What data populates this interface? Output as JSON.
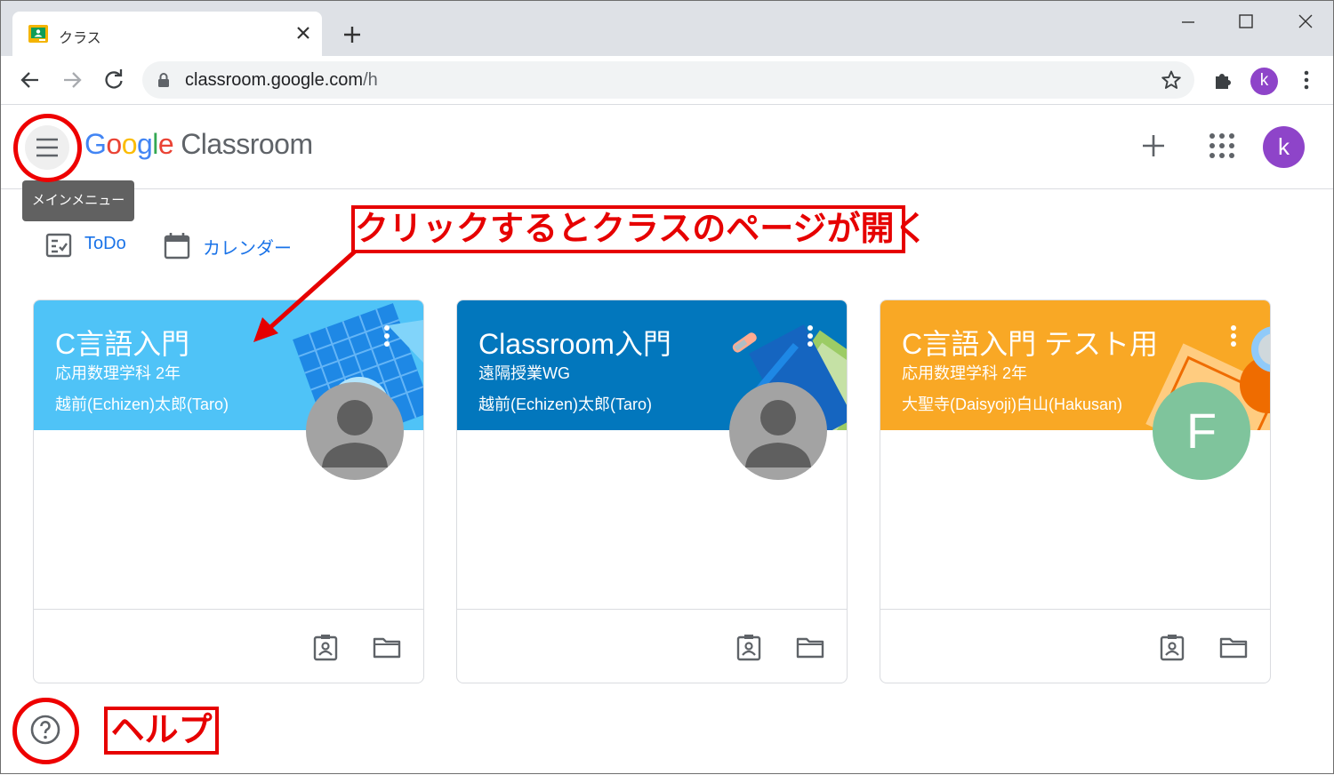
{
  "browser": {
    "tab_title": "クラス",
    "url_host": "classroom.google.com",
    "url_path": "/h",
    "profile_initial": "k"
  },
  "app": {
    "logo_word": [
      "G",
      "o",
      "o",
      "g",
      "l",
      "e"
    ],
    "product": "Classroom",
    "menu_tooltip": "メインメニュー",
    "avatar_initial": "k"
  },
  "quicklinks": {
    "todo": "ToDo",
    "calendar": "カレンダー"
  },
  "cards": [
    {
      "name": "C言語入門",
      "section": "応用数理学科 2年",
      "teacher": "越前(Echizen)太郎(Taro)",
      "banner_color": "#4fc3f7",
      "photo": "person-icon"
    },
    {
      "name": "Classroom入門",
      "section": "遠隔授業WG",
      "teacher": "越前(Echizen)太郎(Taro)",
      "banner_color": "#0277bd",
      "photo": "person-icon"
    },
    {
      "name": "C言語入門 テスト用",
      "section": "応用数理学科 2年",
      "teacher": "大聖寺(Daisyoji)白山(Hakusan)",
      "banner_color": "#f9a825",
      "photo_letter": "F",
      "photo_color": "#7fc49c"
    }
  ],
  "annotations": {
    "callout": "クリックするとクラスのページが開く",
    "help": "ヘルプ",
    "accent": "#e60000"
  }
}
